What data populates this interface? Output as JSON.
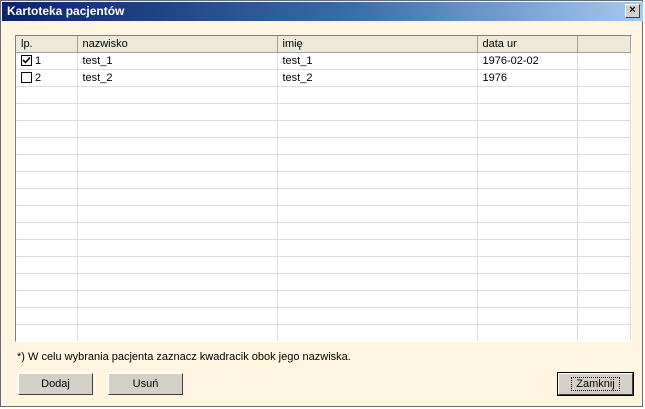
{
  "window": {
    "title": "Kartoteka pacjentów",
    "close_glyph": "×"
  },
  "table": {
    "headers": [
      "lp.",
      "nazwisko",
      "imię",
      "data ur",
      ""
    ],
    "rows": [
      {
        "checked": true,
        "lp": "1",
        "nazwisko": "test_1",
        "imie": "test_1",
        "data_ur": "1976-02-02"
      },
      {
        "checked": false,
        "lp": "2",
        "nazwisko": "test_2",
        "imie": "test_2",
        "data_ur": "1976"
      }
    ]
  },
  "note": "*) W celu wybrania pacjenta zaznacz kwadracik obok jego nazwiska.",
  "buttons": {
    "add": "Dodaj",
    "remove": "Usuń",
    "close": "Zamknij"
  }
}
